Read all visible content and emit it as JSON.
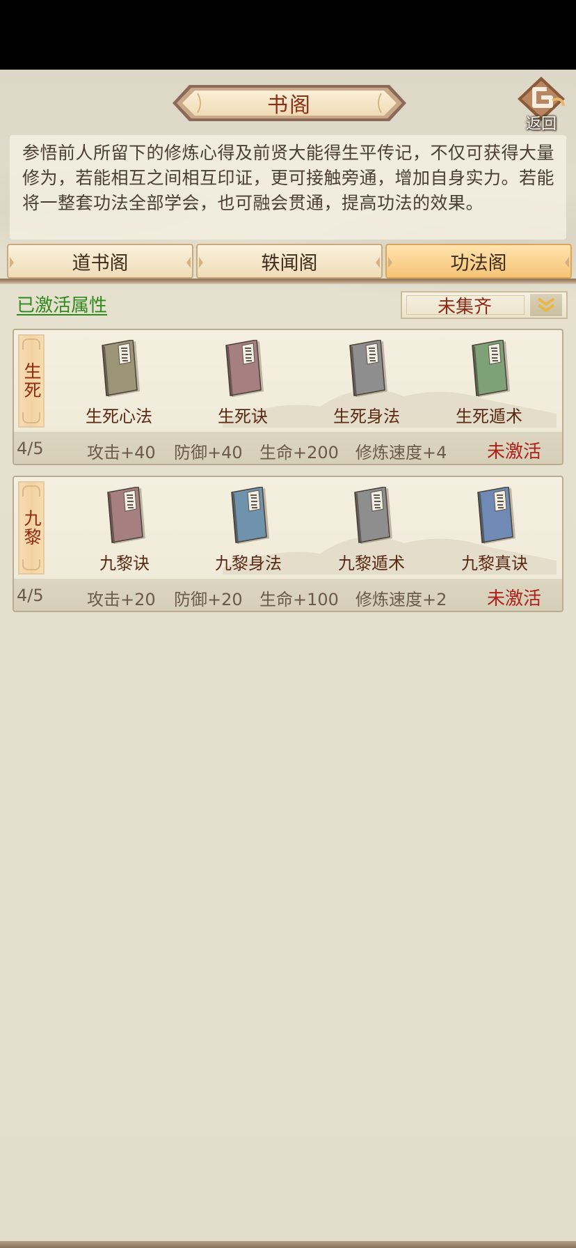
{
  "header": {
    "title": "书阁",
    "back_label": "返回"
  },
  "description": "参悟前人所留下的修炼心得及前贤大能得生平传记，不仅可获得大量修为，若能相互之间相互印证，更可接触旁通，增加自身实力。若能将一整套功法全部学会，也可融会贯通，提高功法的效果。",
  "tabs": [
    {
      "label": "道书阁",
      "active": false
    },
    {
      "label": "轶闻阁",
      "active": false
    },
    {
      "label": "功法阁",
      "active": true
    }
  ],
  "activated_link": "已激活属性",
  "filter": {
    "selected": "未集齐"
  },
  "sets": [
    {
      "name": "生死",
      "books": [
        {
          "name": "生死心法",
          "cover_text": "心法",
          "color": "#9d9578"
        },
        {
          "name": "生死诀",
          "cover_text": "战诀",
          "color": "#a68080"
        },
        {
          "name": "生死身法",
          "cover_text": "身法",
          "color": "#8e8e8e"
        },
        {
          "name": "生死遁术",
          "cover_text": "遁术",
          "color": "#7fa178"
        }
      ],
      "progress": "4/5",
      "stats": [
        "攻击+40",
        "防御+40",
        "生命+200",
        "修炼速度+4"
      ],
      "status": "未激活"
    },
    {
      "name": "九黎",
      "books": [
        {
          "name": "九黎诀",
          "cover_text": "战诀",
          "color": "#a68080"
        },
        {
          "name": "九黎身法",
          "cover_text": "身法",
          "color": "#6f93ad"
        },
        {
          "name": "九黎遁术",
          "cover_text": "遁术",
          "color": "#8e8e8e"
        },
        {
          "name": "九黎真诀",
          "cover_text": "真诀",
          "color": "#6f8bb5"
        }
      ],
      "progress": "4/5",
      "stats": [
        "攻击+20",
        "防御+20",
        "生命+100",
        "修炼速度+2"
      ],
      "status": "未激活"
    }
  ],
  "colors": {
    "title_red": "#8d2d16",
    "link_green": "#2f8a1e",
    "inactive_red": "#b0201a",
    "tab_active": "#f5c377"
  }
}
